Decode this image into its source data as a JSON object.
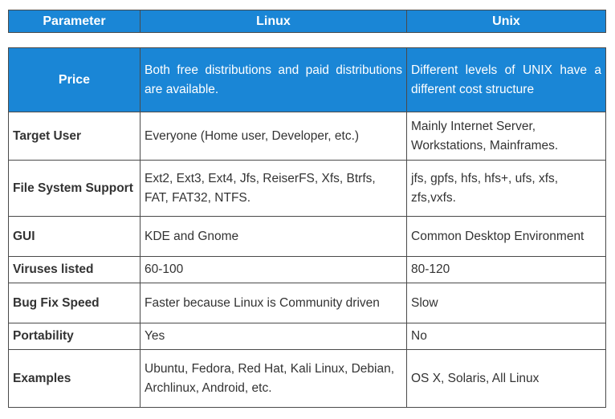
{
  "header": {
    "parameter": "Parameter",
    "linux": "Linux",
    "unix": "Unix"
  },
  "rows": [
    {
      "parameter": "Price",
      "linux": "Both free distributions and paid distributions are available.",
      "unix": "Different levels of UNIX have a different cost structure"
    },
    {
      "parameter": "Target User",
      "linux": "Everyone (Home user, Developer, etc.)",
      "unix": "Mainly Internet Server, Workstations, Mainframes."
    },
    {
      "parameter": "File System Support",
      "linux": "Ext2, Ext3, Ext4, Jfs, ReiserFS, Xfs, Btrfs, FAT, FAT32, NTFS.",
      "unix": "jfs, gpfs, hfs, hfs+, ufs, xfs, zfs,vxfs."
    },
    {
      "parameter": "GUI",
      "linux": "KDE and Gnome",
      "unix": "Common Desktop Environment"
    },
    {
      "parameter": "Viruses listed",
      "linux": "60-100",
      "unix": "80-120"
    },
    {
      "parameter": "Bug Fix Speed",
      "linux": "Faster because Linux is Community driven",
      "unix": "Slow"
    },
    {
      "parameter": "Portability",
      "linux": "Yes",
      "unix": "No"
    },
    {
      "parameter": "Examples",
      "linux": "Ubuntu, Fedora, Red Hat, Kali Linux, Debian, Archlinux, Android, etc.",
      "unix": "OS X, Solaris, All Linux"
    }
  ],
  "colors": {
    "header_bg": "#1a86d6",
    "header_text": "#ffffff",
    "border": "#4a4a4a",
    "body_text": "#333333"
  }
}
